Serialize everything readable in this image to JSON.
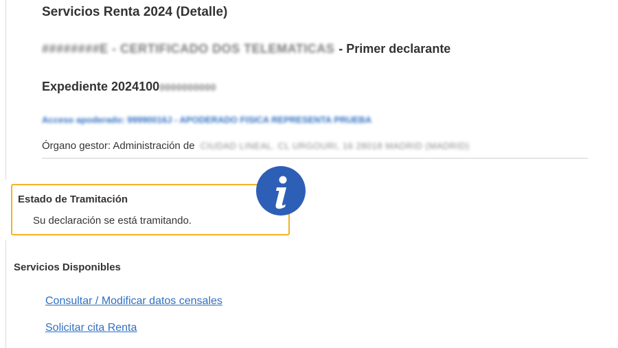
{
  "page": {
    "title": "Servicios Renta 2024 (Detalle)"
  },
  "declarant": {
    "redacted_id": "########E - CERTIFICADO DOS TELEMATICAS",
    "suffix": "- Primer declarante"
  },
  "expediente": {
    "label": "Expediente 2024100",
    "redacted": "0000000000"
  },
  "apoderado": {
    "text": "Acceso apoderado: 99990016J - APODERADO FISICA REPRESENTA PRUEBA"
  },
  "organo": {
    "label": "Órgano gestor: Administración de",
    "redacted": "CIUDAD LINEAL. CL URGOURI, 16 28018 MADRID (MADRID)"
  },
  "status": {
    "title": "Estado de Tramitación",
    "text": "Su declaración se está tramitando.",
    "icon": "info-icon",
    "border_color": "#f3b223",
    "icon_color": "#2d5fb6"
  },
  "services": {
    "title": "Servicios Disponibles",
    "links": [
      {
        "label": "Consultar / Modificar datos censales"
      },
      {
        "label": "Solicitar cita Renta"
      }
    ],
    "link_color": "#2f6fc2"
  }
}
